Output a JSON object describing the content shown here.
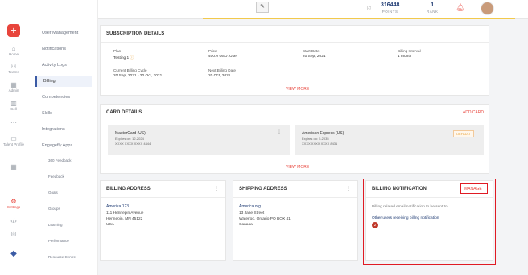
{
  "rail": [
    {
      "name": "home",
      "label": "Home",
      "icon": "house-icon",
      "glyph": "⌂"
    },
    {
      "name": "teams",
      "label": "Teams",
      "icon": "people-icon",
      "glyph": "⚇"
    },
    {
      "name": "admin",
      "label": "Admin",
      "icon": "building-icon",
      "glyph": "▦"
    },
    {
      "name": "cell",
      "label": "Cell",
      "icon": "chart-icon",
      "glyph": "▥"
    },
    {
      "name": "more",
      "label": "",
      "icon": "more-icon",
      "glyph": "···"
    },
    {
      "name": "talent",
      "label": "Talent Profile",
      "icon": "id-card-icon",
      "glyph": "▭"
    },
    {
      "name": "grid",
      "label": "",
      "icon": "grid-icon",
      "glyph": "▦"
    },
    {
      "name": "settings",
      "label": "Settings",
      "icon": "gear-icon",
      "glyph": "⚙"
    },
    {
      "name": "code",
      "label": "",
      "icon": "code-icon",
      "glyph": "‹/›"
    },
    {
      "name": "help",
      "label": "",
      "icon": "help-icon",
      "glyph": "◎"
    }
  ],
  "sidenav": {
    "items": [
      "User Management",
      "Notifications",
      "Activity Logs",
      "Billing",
      "Competencies",
      "Skills",
      "Integrations",
      "Engagefly Apps"
    ],
    "subitems": [
      "360 Feedback",
      "Feedback",
      "Goals",
      "Groups",
      "Learning",
      "Performance",
      "Resource Centre"
    ]
  },
  "header": {
    "logo_text": "✎",
    "points_value": "316448",
    "points_label": "POINTS",
    "rank_value": "1",
    "rank_label": "RANK"
  },
  "subscription": {
    "title": "SUBSCRIPTION DETAILS",
    "plan_label": "Plan",
    "plan_value": "Testing 1",
    "price_label": "Price",
    "price_value": "400.0 USD /User",
    "start_label": "Start Date",
    "start_value": "20 Sep, 2021",
    "interval_label": "Billing Interval",
    "interval_value": "1 month",
    "cycle_label": "Current Billing Cycle",
    "cycle_value": "20 Sep, 2021 - 20 Oct, 2021",
    "next_label": "Next Billing Date",
    "next_value": "20 Oct, 2021",
    "view_more": "VIEW MORE"
  },
  "cards": {
    "title": "CARD DETAILS",
    "add_label": "ADD CARD",
    "view_more": "VIEW MORE",
    "items": [
      {
        "name": "MasterCard (US)",
        "expires": "Expires on: 12-2024",
        "number": "XXXX XXXX XXXX 4444"
      },
      {
        "name": "American Express (US)",
        "expires": "Expires on: 5-2035",
        "number": "XXXX XXXX XXXX 8431",
        "badge": "DEFAULT"
      }
    ]
  },
  "billing_address": {
    "title": "BILLING ADDRESS",
    "name": "America 123",
    "line1": "111 Hennepin Avenue",
    "line2": "Hennepin, MN 45122",
    "line3": "USA"
  },
  "shipping_address": {
    "title": "SHIPPING ADDRESS",
    "name": "America.org",
    "line1": "13 Jane Street",
    "line2": "Waterloo, Ontario PO BOX 41",
    "line3": "Canada"
  },
  "billing_notification": {
    "title": "BILLING NOTIFICATION",
    "manage_label": "MANAGE",
    "desc": "Billing related email notification to be sent to",
    "other_label": "Other users receiving billing notification",
    "count": "2"
  },
  "colors": {
    "accent": "#e8453c",
    "highlight": "#e01b24",
    "brand": "#1f3b73"
  }
}
